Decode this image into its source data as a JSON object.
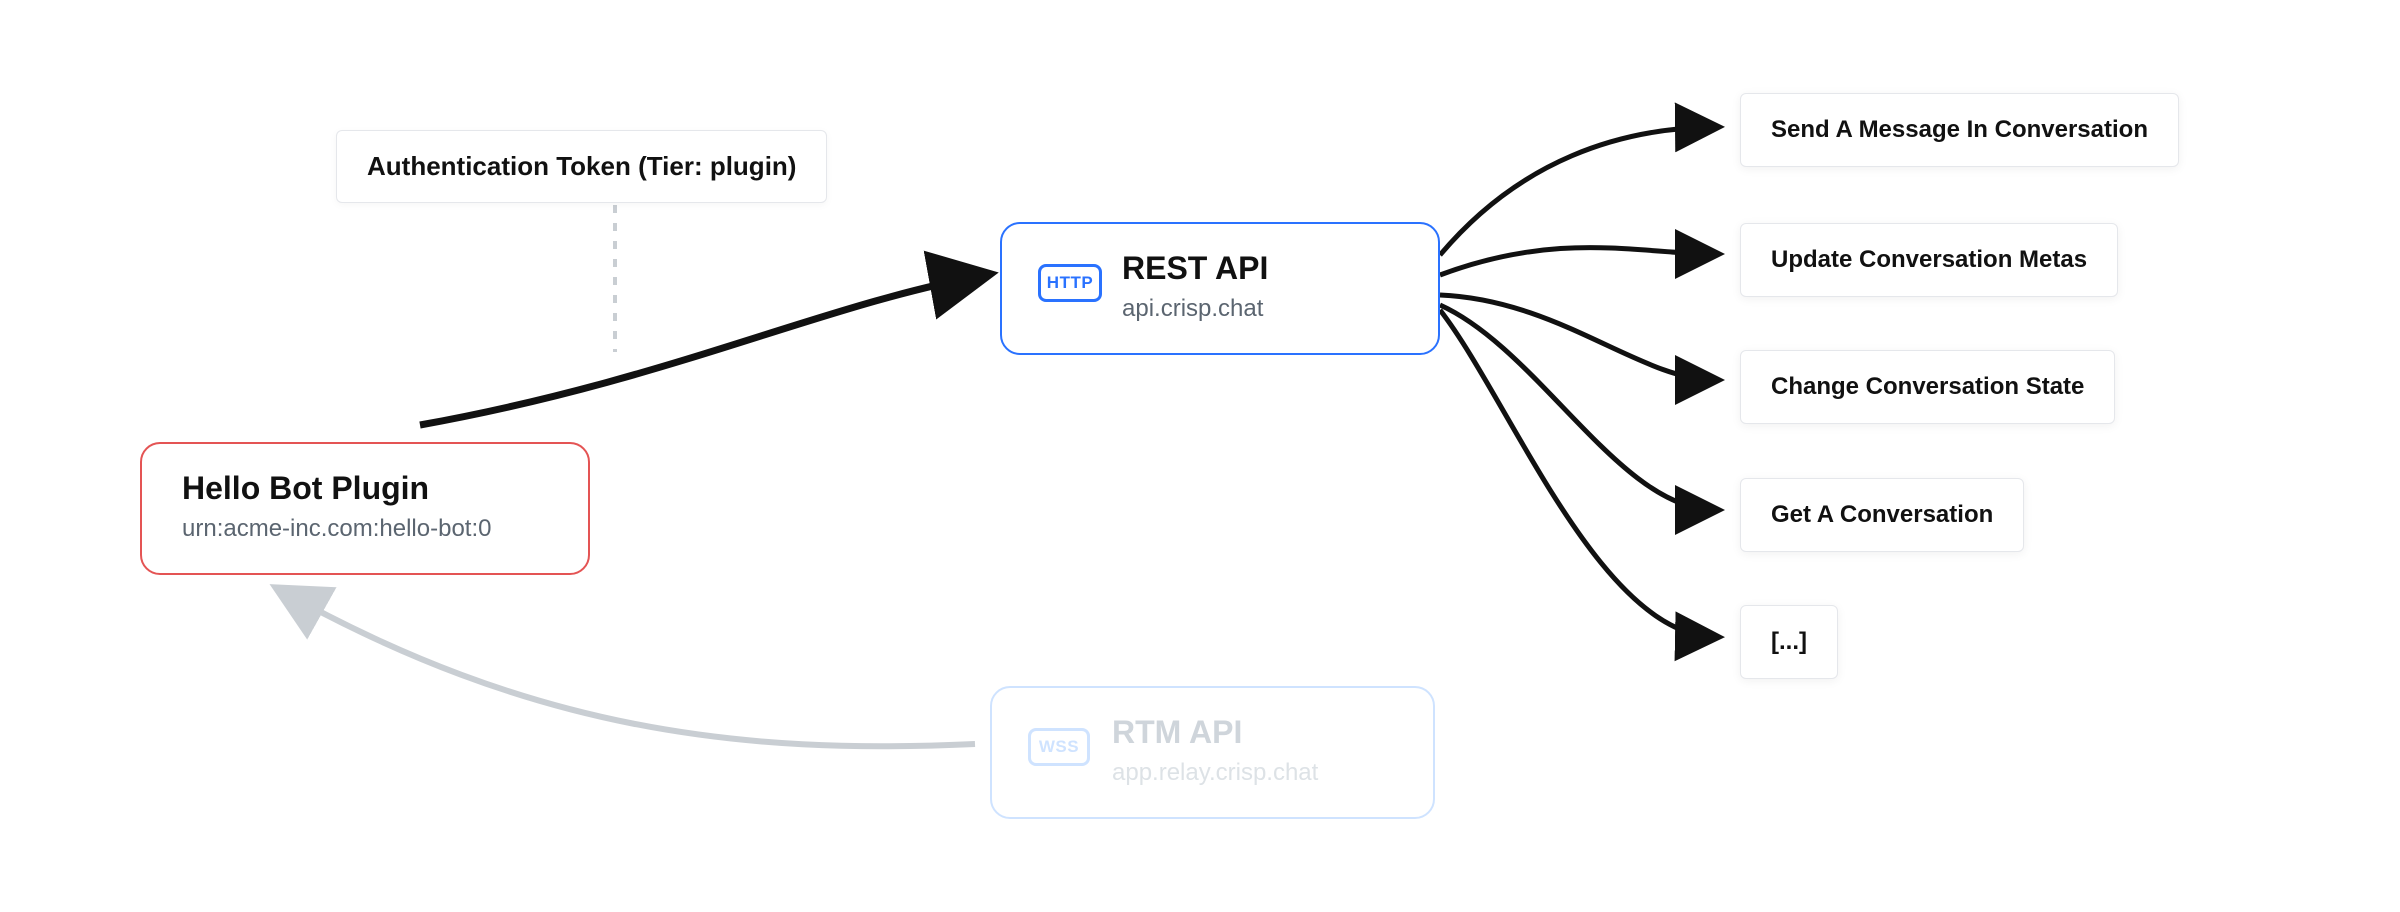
{
  "plugin": {
    "title": "Hello Bot Plugin",
    "urn": "urn:acme-inc.com:hello-bot:0"
  },
  "auth": {
    "label": "Authentication Token (Tier: plugin)"
  },
  "rest": {
    "badge": "HTTP",
    "title": "REST API",
    "host": "api.crisp.chat"
  },
  "rtm": {
    "badge": "WSS",
    "title": "RTM API",
    "host": "app.relay.crisp.chat"
  },
  "actions": [
    "Send A Message In Conversation",
    "Update Conversation Metas",
    "Change Conversation State",
    "Get A Conversation",
    "[...]"
  ]
}
